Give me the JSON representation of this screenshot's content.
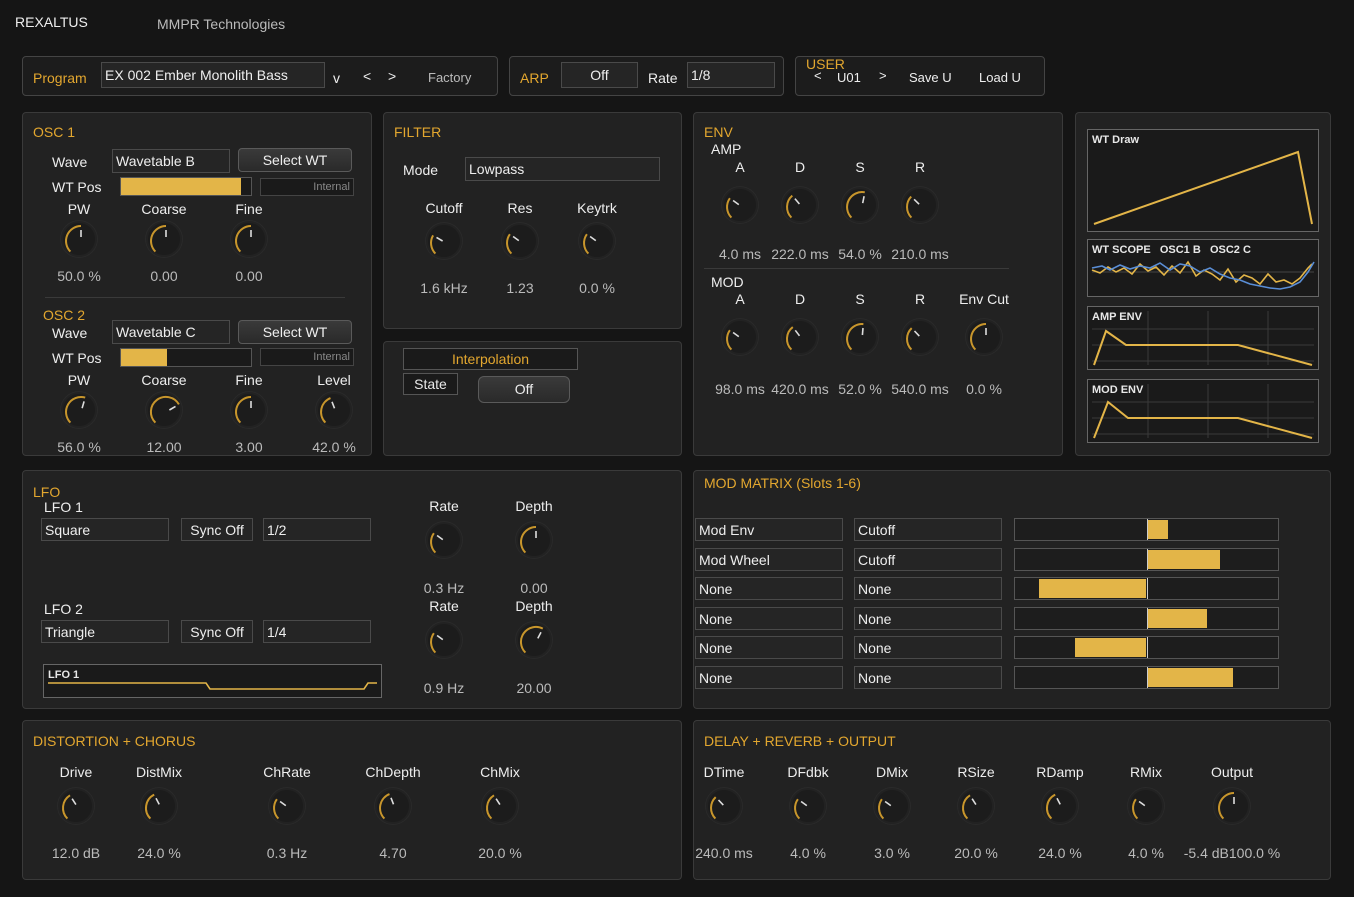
{
  "header": {
    "app": "REXALTUS",
    "vendor": "MMPR Technologies"
  },
  "program": {
    "label": "Program",
    "name": "EX 002 Ember Monolith Bass",
    "dropdown": "v",
    "prev": "<",
    "next": ">",
    "factory": "Factory"
  },
  "arp": {
    "label": "ARP",
    "state": "Off",
    "rate_label": "Rate",
    "rate": "1/8"
  },
  "user": {
    "label": "USER",
    "prev": "<",
    "slot": "U01",
    "next": ">",
    "save": "Save U",
    "load": "Load U"
  },
  "osc1": {
    "title": "OSC 1",
    "wave_label": "Wave",
    "wave": "Wavetable B",
    "select": "Select WT",
    "wtpos_label": "WT Pos",
    "wtpos_tag": "Internal",
    "wtpos": 0.92,
    "knobs": [
      {
        "label": "PW",
        "value": "50.0 %",
        "norm": 0.5
      },
      {
        "label": "Coarse",
        "value": "0.00",
        "norm": 0.5
      },
      {
        "label": "Fine",
        "value": "0.00",
        "norm": 0.5
      }
    ]
  },
  "osc2": {
    "title": "OSC 2",
    "wave_label": "Wave",
    "wave": "Wavetable C",
    "select": "Select WT",
    "wtpos_label": "WT Pos",
    "wtpos_tag": "Internal",
    "wtpos": 0.35,
    "knobs": [
      {
        "label": "PW",
        "value": "56.0 %",
        "norm": 0.56
      },
      {
        "label": "Coarse",
        "value": "12.00",
        "norm": 0.72
      },
      {
        "label": "Fine",
        "value": "3.00",
        "norm": 0.5
      },
      {
        "label": "Level",
        "value": "42.0 %",
        "norm": 0.42
      }
    ]
  },
  "filter": {
    "title": "FILTER",
    "mode_label": "Mode",
    "mode": "Lowpass",
    "knobs": [
      {
        "label": "Cutoff",
        "value": "1.6 kHz",
        "norm": 0.28
      },
      {
        "label": "Res",
        "value": "1.23",
        "norm": 0.3
      },
      {
        "label": "Keytrk",
        "value": "0.0 %",
        "norm": 0.3
      }
    ]
  },
  "interp": {
    "title": "Interpolation",
    "state_label": "State",
    "state": "Off"
  },
  "env": {
    "title": "ENV",
    "amp_label": "AMP",
    "mod_label": "MOD",
    "amp": [
      {
        "label": "A",
        "value": "4.0 ms",
        "norm": 0.3
      },
      {
        "label": "D",
        "value": "222.0 ms",
        "norm": 0.35
      },
      {
        "label": "S",
        "value": "54.0 %",
        "norm": 0.54
      },
      {
        "label": "R",
        "value": "210.0 ms",
        "norm": 0.33
      }
    ],
    "mod": [
      {
        "label": "A",
        "value": "98.0 ms",
        "norm": 0.3
      },
      {
        "label": "D",
        "value": "420.0 ms",
        "norm": 0.36
      },
      {
        "label": "S",
        "value": "52.0 %",
        "norm": 0.52
      },
      {
        "label": "R",
        "value": "540.0 ms",
        "norm": 0.34
      },
      {
        "label": "Env Cut",
        "value": "0.0 %",
        "norm": 0.5
      }
    ]
  },
  "displays": {
    "wt_draw": "WT Draw",
    "wt_scope": "WT SCOPE   OSC1 B   OSC2 C",
    "amp_env": "AMP ENV",
    "mod_env": "MOD ENV"
  },
  "lfo": {
    "title": "LFO",
    "lfo1": {
      "label": "LFO 1",
      "shape": "Square",
      "sync": "Sync Off",
      "div": "1/2",
      "rate_label": "Rate",
      "rate": "0.3 Hz",
      "rate_norm": 0.3,
      "depth_label": "Depth",
      "depth": "0.00",
      "depth_norm": 0.5
    },
    "lfo2": {
      "label": "LFO 2",
      "shape": "Triangle",
      "sync": "Sync Off",
      "div": "1/4",
      "rate_label": "Rate",
      "rate": "0.9 Hz",
      "rate_norm": 0.3,
      "depth_label": "Depth",
      "depth": "20.00",
      "depth_norm": 0.6
    },
    "display": "LFO 1"
  },
  "modmatrix": {
    "title": "MOD MATRIX (Slots 1-6)",
    "rows": [
      {
        "src": "Mod Env",
        "dst": "Cutoff",
        "amt": 0.08
      },
      {
        "src": "Mod Wheel",
        "dst": "Cutoff",
        "amt": 0.28
      },
      {
        "src": "None",
        "dst": "None",
        "amt": -0.41
      },
      {
        "src": "None",
        "dst": "None",
        "amt": 0.23
      },
      {
        "src": "None",
        "dst": "None",
        "amt": -0.27
      },
      {
        "src": "None",
        "dst": "None",
        "amt": 0.33
      }
    ]
  },
  "dist": {
    "title": "DISTORTION + CHORUS",
    "knobs": [
      {
        "label": "Drive",
        "value": "12.0 dB",
        "norm": 0.38
      },
      {
        "label": "DistMix",
        "value": "24.0 %",
        "norm": 0.4
      },
      {
        "label": "ChRate",
        "value": "0.3 Hz",
        "norm": 0.3
      },
      {
        "label": "ChDepth",
        "value": "4.70",
        "norm": 0.42
      },
      {
        "label": "ChMix",
        "value": "20.0 %",
        "norm": 0.38
      }
    ]
  },
  "delay": {
    "title": "DELAY + REVERB + OUTPUT",
    "knobs": [
      {
        "label": "DTime",
        "value": "240.0 ms",
        "norm": 0.34
      },
      {
        "label": "DFdbk",
        "value": "4.0 %",
        "norm": 0.3
      },
      {
        "label": "DMix",
        "value": "3.0 %",
        "norm": 0.3
      },
      {
        "label": "RSize",
        "value": "20.0 %",
        "norm": 0.38
      },
      {
        "label": "RDamp",
        "value": "24.0 %",
        "norm": 0.4
      },
      {
        "label": "RMix",
        "value": "4.0 %",
        "norm": 0.3
      },
      {
        "label": "Output",
        "value": "-5.4 dB100.0 %",
        "norm": 0.5
      }
    ]
  },
  "colors": {
    "accent": "#e3a72f",
    "bar": "#e3b548",
    "trace_blue": "#5a8ed6"
  }
}
